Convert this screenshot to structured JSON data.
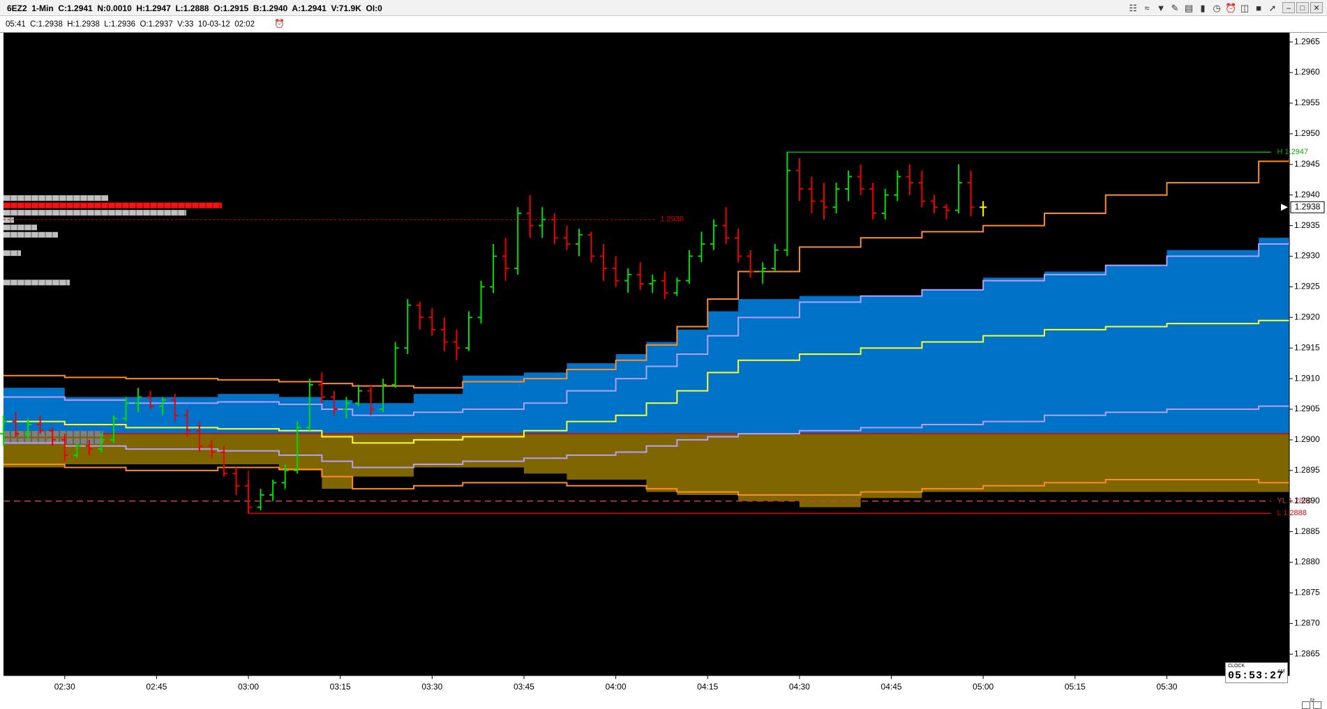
{
  "header": {
    "title": "6EZ2  1-Min  C:1.2941  N:0.0010  H:1.2947  L:1.2888  O:1.2915  B:1.2940  A:1.2941  V:71.9K  OI:0",
    "toolbar_icons": [
      "layers-icon",
      "waves-icon",
      "funnel-icon",
      "pencil-icon",
      "bar-chart-icon",
      "candle-icon",
      "clock-icon",
      "alarm-icon",
      "columns-icon",
      "trash-icon",
      "pointer-icon"
    ],
    "window_controls": [
      "minimize-icon",
      "restore-icon",
      "close-icon"
    ]
  },
  "infobar": {
    "text": "05:41  C:1.2938  H:1.2938  L:1.2936  O:1.2937  V:33  10-03-12  02:02"
  },
  "clock": {
    "caption": "CLOCK",
    "time": "05:53:27",
    "suffix": "AM"
  },
  "tz": "tz",
  "chart_data": {
    "type": "line",
    "background": "#000000",
    "x_labels": [
      "02:30",
      "02:45",
      "03:00",
      "03:15",
      "03:30",
      "03:45",
      "04:00",
      "04:15",
      "04:30",
      "04:45",
      "05:00",
      "05:15",
      "05:30"
    ],
    "y_ticks": [
      "1.2965",
      "1.2960",
      "1.2955",
      "1.2950",
      "1.2945",
      "1.2940",
      "1.2935",
      "1.2930",
      "1.2925",
      "1.2920",
      "1.2915",
      "1.2910",
      "1.2905",
      "1.2900",
      "1.2895",
      "1.2890",
      "1.2885",
      "1.2880",
      "1.2875",
      "1.2870",
      "1.2865"
    ],
    "ylim": [
      1.28615,
      1.29665
    ],
    "xlim_minutes": [
      140,
      350
    ],
    "last_price": "1.2938",
    "price_line_label": "1.2936",
    "high_label": "H 1.2947",
    "yl_label": "YL 1.2890",
    "low_label": "L 1.2888",
    "levels": {
      "price_line": 1.2936,
      "high": 1.2947,
      "yesterday_low": 1.289,
      "low": 1.2888,
      "last": 1.2938
    },
    "colors": {
      "up": "#00dd00",
      "down": "#ee0000",
      "neutral": "#ffff00",
      "blue_band": "#0073c8",
      "olive_band": "#806600",
      "orange": "#ff8c28",
      "lavender": "#b4a0ff",
      "yellow": "#ffff28",
      "high_line": "#00b400",
      "low_line": "#dc0000",
      "yl_line": "#cd3c50"
    },
    "series": [
      {
        "name": "upper-orange",
        "x": [
          140,
          150,
          160,
          175,
          185,
          192,
          197,
          207,
          215,
          225,
          232,
          240,
          245,
          250,
          255,
          260,
          270,
          280,
          290,
          300,
          310,
          320,
          330,
          345,
          350
        ],
        "y": [
          1.29105,
          1.29102,
          1.291,
          1.29098,
          1.29095,
          1.29092,
          1.29088,
          1.29085,
          1.29095,
          1.291,
          1.29115,
          1.2913,
          1.29155,
          1.29185,
          1.2923,
          1.29275,
          1.29315,
          1.2933,
          1.2934,
          1.2935,
          1.2937,
          1.294,
          1.2942,
          1.29455,
          1.2946
        ]
      },
      {
        "name": "upper-lavender",
        "x": [
          140,
          150,
          160,
          175,
          185,
          192,
          197,
          207,
          215,
          225,
          232,
          240,
          245,
          250,
          255,
          260,
          270,
          280,
          290,
          300,
          310,
          320,
          330,
          345,
          350
        ],
        "y": [
          1.2907,
          1.29065,
          1.2906,
          1.29062,
          1.29058,
          1.2905,
          1.2904,
          1.29045,
          1.2905,
          1.2906,
          1.2908,
          1.291,
          1.2912,
          1.2914,
          1.2917,
          1.292,
          1.29225,
          1.29235,
          1.29245,
          1.2926,
          1.2927,
          1.29285,
          1.293,
          1.2932,
          1.29325
        ]
      },
      {
        "name": "mid-yellow",
        "x": [
          140,
          150,
          160,
          175,
          185,
          192,
          197,
          207,
          215,
          225,
          232,
          240,
          245,
          250,
          255,
          260,
          270,
          280,
          290,
          300,
          310,
          320,
          330,
          345,
          350
        ],
        "y": [
          1.2903,
          1.29025,
          1.2902,
          1.29018,
          1.29015,
          1.29005,
          1.28995,
          1.29,
          1.29005,
          1.29015,
          1.2903,
          1.2904,
          1.2906,
          1.2908,
          1.2911,
          1.2913,
          1.2914,
          1.2915,
          1.2916,
          1.2917,
          1.2918,
          1.29185,
          1.2919,
          1.29195,
          1.29195
        ]
      },
      {
        "name": "lower-lavender",
        "x": [
          140,
          150,
          160,
          175,
          185,
          192,
          197,
          207,
          215,
          225,
          232,
          240,
          245,
          250,
          255,
          260,
          270,
          280,
          290,
          300,
          310,
          320,
          330,
          345,
          350
        ],
        "y": [
          1.28995,
          1.2899,
          1.28985,
          1.28982,
          1.28975,
          1.28965,
          1.28955,
          1.2896,
          1.28965,
          1.2897,
          1.28975,
          1.2898,
          1.2899,
          1.29,
          1.29005,
          1.2901,
          1.29015,
          1.2902,
          1.29025,
          1.2903,
          1.2904,
          1.29045,
          1.2905,
          1.29055,
          1.29055
        ]
      },
      {
        "name": "lower-orange",
        "x": [
          140,
          150,
          160,
          175,
          185,
          192,
          197,
          207,
          215,
          225,
          232,
          240,
          245,
          250,
          255,
          260,
          270,
          280,
          290,
          300,
          310,
          320,
          330,
          345,
          350
        ],
        "y": [
          1.2896,
          1.28955,
          1.2895,
          1.28955,
          1.28952,
          1.2894,
          1.2892,
          1.28925,
          1.2893,
          1.2893,
          1.28925,
          1.28925,
          1.2892,
          1.28915,
          1.28915,
          1.2891,
          1.2891,
          1.28915,
          1.2892,
          1.28925,
          1.2893,
          1.28935,
          1.28935,
          1.2893,
          1.2893
        ]
      }
    ],
    "bands": [
      {
        "name": "blue",
        "x": [
          140,
          150,
          160,
          175,
          185,
          192,
          197,
          207,
          215,
          225,
          232,
          240,
          245,
          250,
          255,
          260,
          270,
          280,
          290,
          300,
          310,
          320,
          330,
          345,
          350
        ],
        "upper": [
          1.29085,
          1.2907,
          1.2907,
          1.29075,
          1.2907,
          1.29065,
          1.2906,
          1.29075,
          1.29105,
          1.2911,
          1.29125,
          1.2914,
          1.2916,
          1.2918,
          1.2921,
          1.2923,
          1.29235,
          1.29235,
          1.29245,
          1.29265,
          1.29275,
          1.29285,
          1.2931,
          1.2933,
          1.2933
        ],
        "lower": [
          1.2901,
          1.2901,
          1.2901,
          1.2901,
          1.2901,
          1.2901,
          1.2901,
          1.2901,
          1.2901,
          1.2901,
          1.2901,
          1.2901,
          1.2901,
          1.2901,
          1.2901,
          1.2901,
          1.2901,
          1.2901,
          1.2901,
          1.2901,
          1.2901,
          1.2901,
          1.2901,
          1.2901,
          1.2901
        ]
      },
      {
        "name": "olive",
        "x": [
          140,
          150,
          160,
          175,
          185,
          192,
          197,
          207,
          215,
          225,
          232,
          240,
          245,
          250,
          255,
          260,
          270,
          280,
          290,
          300,
          310,
          320,
          330,
          345,
          350
        ],
        "upper": [
          1.2901,
          1.2901,
          1.2901,
          1.2901,
          1.2901,
          1.2901,
          1.2901,
          1.2901,
          1.2901,
          1.2901,
          1.2901,
          1.2901,
          1.2901,
          1.2901,
          1.2901,
          1.2901,
          1.2901,
          1.2901,
          1.2901,
          1.2901,
          1.2901,
          1.2901,
          1.2901,
          1.2901,
          1.2901
        ],
        "lower": [
          1.28955,
          1.28955,
          1.2896,
          1.2896,
          1.2896,
          1.2895,
          1.2892,
          1.2894,
          1.28955,
          1.28955,
          1.28945,
          1.28935,
          1.28935,
          1.28915,
          1.2891,
          1.2891,
          1.289,
          1.2889,
          1.28905,
          1.28915,
          1.28915,
          1.28915,
          1.28915,
          1.28915,
          1.28915
        ]
      }
    ],
    "bars": [
      [
        140,
        1.2901,
        1.2904,
        1.2899,
        1.2903
      ],
      [
        142,
        1.2903,
        1.29045,
        1.29005,
        1.2901
      ],
      [
        144,
        1.2901,
        1.29035,
        1.29,
        1.29025
      ],
      [
        146,
        1.29025,
        1.2904,
        1.2901,
        1.29015
      ],
      [
        148,
        1.29015,
        1.2902,
        1.2899,
        1.29
      ],
      [
        150,
        1.29,
        1.2901,
        1.28965,
        1.28975
      ],
      [
        152,
        1.28975,
        1.28995,
        1.2897,
        1.2899
      ],
      [
        154,
        1.2899,
        1.29,
        1.28975,
        1.28985
      ],
      [
        156,
        1.28985,
        1.2901,
        1.2898,
        1.29
      ],
      [
        158,
        1.29,
        1.2904,
        1.28995,
        1.29035
      ],
      [
        160,
        1.29035,
        1.2907,
        1.2903,
        1.2906
      ],
      [
        162,
        1.2906,
        1.29085,
        1.29045,
        1.2907
      ],
      [
        164,
        1.2907,
        1.2908,
        1.2905,
        1.29055
      ],
      [
        166,
        1.29055,
        1.2907,
        1.2904,
        1.29065
      ],
      [
        168,
        1.29065,
        1.29075,
        1.2903,
        1.2904
      ],
      [
        170,
        1.2904,
        1.2905,
        1.29005,
        1.29015
      ],
      [
        172,
        1.29015,
        1.2903,
        1.2898,
        1.2899
      ],
      [
        174,
        1.2899,
        1.29,
        1.2897,
        1.2898
      ],
      [
        176,
        1.2898,
        1.2899,
        1.2894,
        1.28945
      ],
      [
        178,
        1.28945,
        1.28955,
        1.2891,
        1.28925
      ],
      [
        180,
        1.28925,
        1.28935,
        1.2888,
        1.2889
      ],
      [
        182,
        1.2889,
        1.2892,
        1.28885,
        1.2891
      ],
      [
        184,
        1.2891,
        1.28935,
        1.289,
        1.2893
      ],
      [
        186,
        1.2893,
        1.2896,
        1.2892,
        1.2895
      ],
      [
        188,
        1.2895,
        1.2903,
        1.28945,
        1.2902
      ],
      [
        190,
        1.2902,
        1.291,
        1.29015,
        1.2909
      ],
      [
        192,
        1.2909,
        1.2911,
        1.2906,
        1.2907
      ],
      [
        194,
        1.2907,
        1.2908,
        1.2904,
        1.2905
      ],
      [
        196,
        1.2905,
        1.2907,
        1.29035,
        1.2906
      ],
      [
        198,
        1.2906,
        1.2909,
        1.29055,
        1.2908
      ],
      [
        200,
        1.2908,
        1.2909,
        1.2904,
        1.2905
      ],
      [
        202,
        1.2905,
        1.291,
        1.29045,
        1.2909
      ],
      [
        204,
        1.2909,
        1.2916,
        1.29085,
        1.2915
      ],
      [
        206,
        1.2915,
        1.2923,
        1.2914,
        1.2922
      ],
      [
        208,
        1.2922,
        1.29225,
        1.2918,
        1.292
      ],
      [
        210,
        1.292,
        1.29215,
        1.2917,
        1.2918
      ],
      [
        212,
        1.2918,
        1.292,
        1.29145,
        1.2916
      ],
      [
        214,
        1.2916,
        1.2918,
        1.2913,
        1.2915
      ],
      [
        216,
        1.2915,
        1.2921,
        1.29145,
        1.292
      ],
      [
        218,
        1.292,
        1.2926,
        1.2919,
        1.2925
      ],
      [
        220,
        1.2925,
        1.2932,
        1.2924,
        1.293
      ],
      [
        222,
        1.293,
        1.2933,
        1.2926,
        1.2928
      ],
      [
        224,
        1.2928,
        1.2938,
        1.2927,
        1.2937
      ],
      [
        226,
        1.2937,
        1.294,
        1.2933,
        1.2935
      ],
      [
        228,
        1.2935,
        1.2938,
        1.2933,
        1.2936
      ],
      [
        230,
        1.2936,
        1.2937,
        1.2932,
        1.2933
      ],
      [
        232,
        1.2933,
        1.2935,
        1.2931,
        1.2932
      ],
      [
        234,
        1.2932,
        1.29345,
        1.293,
        1.29335
      ],
      [
        236,
        1.29335,
        1.2934,
        1.2929,
        1.293
      ],
      [
        238,
        1.293,
        1.2932,
        1.2926,
        1.2928
      ],
      [
        240,
        1.2928,
        1.293,
        1.2925,
        1.2926
      ],
      [
        242,
        1.2926,
        1.2928,
        1.2924,
        1.2927
      ],
      [
        244,
        1.2927,
        1.2929,
        1.29245,
        1.29255
      ],
      [
        246,
        1.29255,
        1.2927,
        1.2924,
        1.2926
      ],
      [
        248,
        1.2926,
        1.29275,
        1.2923,
        1.2924
      ],
      [
        250,
        1.2924,
        1.29265,
        1.29235,
        1.2926
      ],
      [
        252,
        1.2926,
        1.2931,
        1.29255,
        1.293
      ],
      [
        254,
        1.293,
        1.2934,
        1.2929,
        1.2932
      ],
      [
        256,
        1.2932,
        1.2936,
        1.2931,
        1.2935
      ],
      [
        258,
        1.2935,
        1.2938,
        1.2932,
        1.2933
      ],
      [
        260,
        1.2933,
        1.29345,
        1.2929,
        1.293
      ],
      [
        262,
        1.293,
        1.2931,
        1.29265,
        1.29275
      ],
      [
        264,
        1.29275,
        1.2929,
        1.29255,
        1.2928
      ],
      [
        266,
        1.2928,
        1.2932,
        1.29275,
        1.2931
      ],
      [
        268,
        1.2931,
        1.2947,
        1.293,
        1.2944
      ],
      [
        270,
        1.2944,
        1.2946,
        1.2939,
        1.2941
      ],
      [
        272,
        1.2941,
        1.2943,
        1.2937,
        1.2939
      ],
      [
        274,
        1.2939,
        1.2942,
        1.2936,
        1.2938
      ],
      [
        276,
        1.2938,
        1.2942,
        1.2937,
        1.2941
      ],
      [
        278,
        1.2941,
        1.2944,
        1.2939,
        1.2943
      ],
      [
        280,
        1.2943,
        1.2945,
        1.294,
        1.2941
      ],
      [
        282,
        1.2941,
        1.2942,
        1.2936,
        1.2937
      ],
      [
        284,
        1.2937,
        1.2941,
        1.2936,
        1.294
      ],
      [
        286,
        1.294,
        1.2944,
        1.2939,
        1.2943
      ],
      [
        288,
        1.2943,
        1.2945,
        1.294,
        1.2942
      ],
      [
        290,
        1.2942,
        1.2944,
        1.2938,
        1.2939
      ],
      [
        292,
        1.2939,
        1.294,
        1.2937,
        1.2938
      ],
      [
        294,
        1.2938,
        1.29385,
        1.2936,
        1.29375
      ],
      [
        296,
        1.29375,
        1.2945,
        1.2937,
        1.2942
      ],
      [
        298,
        1.2942,
        1.2944,
        1.29365,
        1.2938
      ],
      [
        300,
        1.2938,
        1.2939,
        1.29365,
        1.2938
      ]
    ],
    "dom_bars": [
      {
        "value_px": 150,
        "color": "#c0c0c0",
        "price": 1.29395
      },
      {
        "value_px": 313,
        "color": "#ff1010",
        "price": 1.29383
      },
      {
        "value_px": 262,
        "color": "#c0c0c0",
        "price": 1.29371
      },
      {
        "value_px": 15,
        "color": "#c0c0c0",
        "price": 1.29359
      },
      {
        "value_px": 48,
        "color": "#c0c0c0",
        "price": 1.29347
      },
      {
        "value_px": 78,
        "color": "#c0c0c0",
        "price": 1.29335
      },
      {
        "value_px": 25,
        "color": "#c0c0c0",
        "price": 1.29305
      },
      {
        "value_px": 95,
        "color": "#c0c0c0",
        "price": 1.29257
      },
      {
        "value_px": 143,
        "color": "#808080",
        "price": 1.2901
      },
      {
        "value_px": 143,
        "color": "#808080",
        "price": 1.28998
      }
    ]
  }
}
